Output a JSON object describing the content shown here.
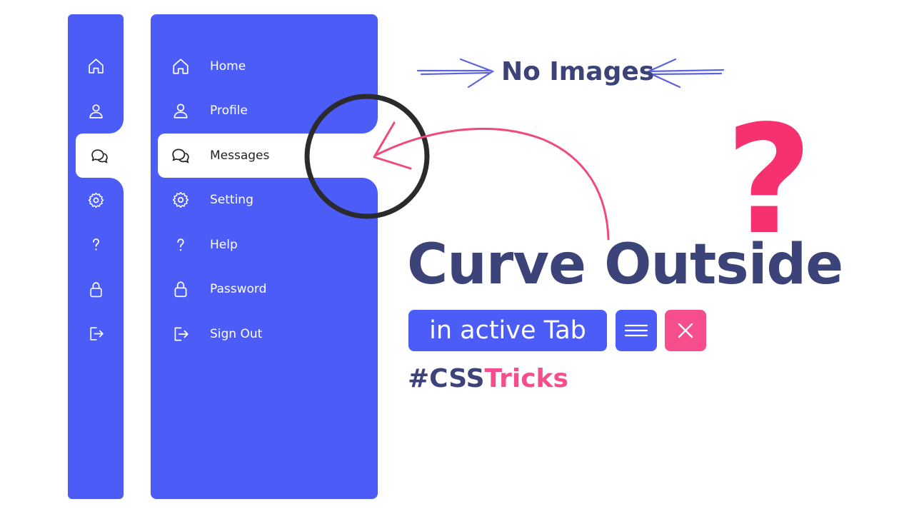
{
  "sidebar_small": {
    "items": [
      {
        "icon": "home-icon"
      },
      {
        "icon": "user-icon"
      },
      {
        "icon": "messages-icon",
        "active": true
      },
      {
        "icon": "gear-icon"
      },
      {
        "icon": "help-icon"
      },
      {
        "icon": "lock-icon"
      },
      {
        "icon": "sign-out-icon"
      }
    ]
  },
  "sidebar_big": {
    "items": [
      {
        "label": "Home",
        "icon": "home-icon"
      },
      {
        "label": "Profile",
        "icon": "user-icon"
      },
      {
        "label": "Messages",
        "icon": "messages-icon",
        "active": true
      },
      {
        "label": "Setting",
        "icon": "gear-icon"
      },
      {
        "label": "Help",
        "icon": "help-icon"
      },
      {
        "label": "Password",
        "icon": "lock-icon"
      },
      {
        "label": "Sign Out",
        "icon": "sign-out-icon"
      }
    ]
  },
  "banner": {
    "no_images": "No Images",
    "headline": "Curve Outside",
    "chip": "in active Tab",
    "hashtag_a": "#CSS",
    "hashtag_b": "Tricks",
    "question": "?"
  },
  "colors": {
    "primary": "#4c5cf7",
    "accent": "#f64e8c",
    "text_dark": "#3c4378",
    "question": "#f6316f"
  }
}
